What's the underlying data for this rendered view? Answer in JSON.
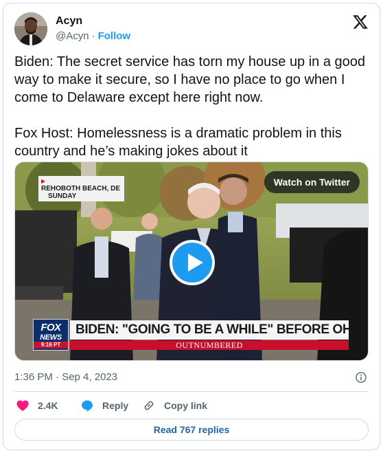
{
  "author": {
    "name": "Acyn",
    "handle": "@Acyn",
    "separator": "·",
    "follow_label": "Follow"
  },
  "tweet": {
    "text": "Biden: The secret service has torn my house up in a good way to make it secure, so I have no place to go when I come to Delaware except here right now.\n\nFox Host: Homelessness is a dramatic problem in this country and he’s making jokes about it"
  },
  "media": {
    "watch_label": "Watch on Twitter",
    "location_line1": "REHOBOTH BEACH, DE",
    "location_line2": "SUNDAY",
    "network_line1": "FOX",
    "network_line2": "NEWS",
    "clock": "9:16 PT",
    "headline": "BIDEN: \"GOING TO BE A WHILE\" BEFORE OHIO VISIT",
    "show_name": "OUTNUMBERED"
  },
  "meta": {
    "timestamp": "1:36 PM · Sep 4, 2023"
  },
  "actions": {
    "like_count": "2.4K",
    "reply_label": "Reply",
    "copy_label": "Copy link"
  },
  "footer": {
    "read_replies_label": "Read 767 replies"
  },
  "colors": {
    "accent": "#1d9bf0",
    "like": "#f91880",
    "muted": "#536471",
    "border": "#cfd9de"
  },
  "icons": [
    "x-logo-icon",
    "play-icon",
    "info-icon",
    "heart-icon",
    "reply-bubble-icon",
    "link-icon"
  ]
}
